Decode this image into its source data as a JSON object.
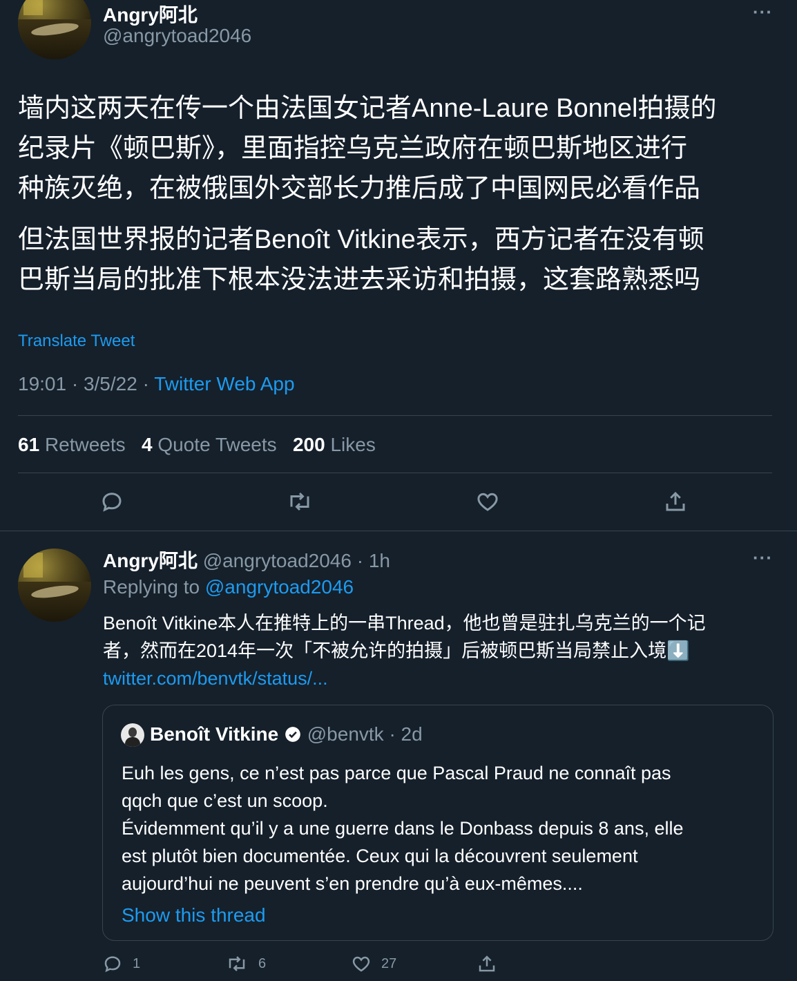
{
  "main_tweet": {
    "author_name": "Angry阿北",
    "handle": "@angrytoad2046",
    "more_glyph": "···",
    "text_lines": [
      "墙内这两天在传一个由法国女记者Anne-Laure Bonnel拍摄的",
      "纪录片《顿巴斯》，里面指控乌克兰政府在顿巴斯地区进行",
      "种族灭绝，在被俄国外交部长力推后成了中国网民必看作品",
      "但法国世界报的记者Benoît Vitkine表示，西方记者在没有顿",
      "巴斯当局的批准下根本没法进去采访和拍摄，这套路熟悉吗"
    ],
    "translate_label": "Translate Tweet",
    "timestamp": "19:01 · 3/5/22 · ",
    "source": "Twitter Web App",
    "stats": {
      "retweets_count": "61",
      "retweets_label": "Retweets",
      "quotes_count": "4",
      "quotes_label": "Quote Tweets",
      "likes_count": "200",
      "likes_label": "Likes"
    }
  },
  "reply_tweet": {
    "author_name": "Angry阿北",
    "handle_time": "@angrytoad2046 · 1h",
    "replying_prefix": "Replying to ",
    "replying_handle": "@angrytoad2046",
    "more_glyph": "···",
    "text_line_1": "Benoît Vitkine本人在推特上的一串Thread，他也曾是驻扎乌克兰的一个记",
    "text_line_2": "者，然而在2014年一次「不被允许的拍摄」后被顿巴斯当局禁止入境⬇️",
    "link": "twitter.com/benvtk/status/...",
    "quoted": {
      "author_name": "Benoît Vitkine",
      "handle_time": "@benvtk · 2d",
      "text_lines": [
        "Euh les gens, ce n’est pas parce que Pascal Praud ne connaît pas",
        "qqch que c’est un scoop.",
        "Évidemment qu’il y a une guerre dans le Donbass depuis 8 ans, elle",
        "est plutôt bien documentée. Ceux qui la découvrent seulement",
        "aujourd’hui ne peuvent s’en prendre qu’à eux-mêmes...."
      ],
      "show_thread": "Show this thread"
    },
    "actions": {
      "reply_count": "1",
      "retweet_count": "6",
      "like_count": "27"
    }
  },
  "colors": {
    "background": "#15202b",
    "link": "#1d9bf0",
    "muted": "#8899a6",
    "divider": "#38444d"
  }
}
